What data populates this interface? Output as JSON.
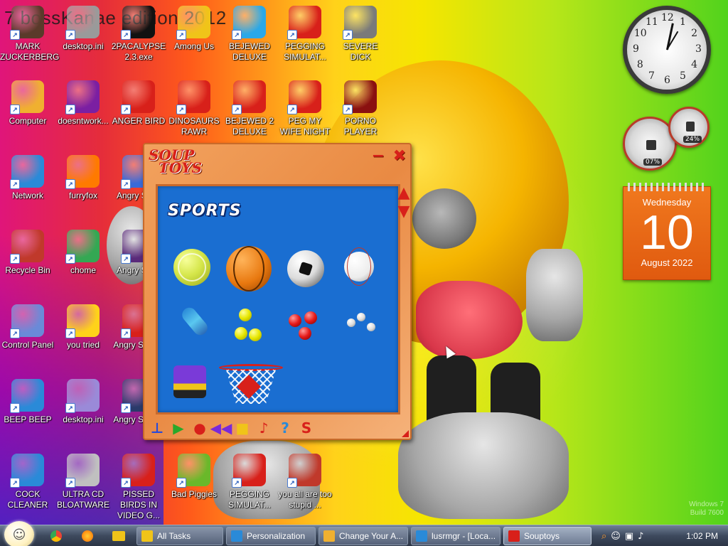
{
  "desktop": {
    "title": "7 bossKanae edition 2012",
    "icons": [
      {
        "label": "MARK ZUCKERBERG",
        "icon": "person-icon",
        "color": "#5a3a2a"
      },
      {
        "label": "desktop.ini",
        "icon": "settings-file-icon",
        "color": "#9a9a9a"
      },
      {
        "label": "2PACALYPSE 2.3.exe",
        "icon": "terminal-icon",
        "color": "#111111"
      },
      {
        "label": "Among Us",
        "icon": "folder-icon",
        "color": "#f0c419"
      },
      {
        "label": "BEJEWED DELUXE",
        "icon": "gem-icon",
        "color": "#2aa8e8"
      },
      {
        "label": "PEGGING SIMULAT...",
        "icon": "p-logo-icon",
        "color": "#d8201a"
      },
      {
        "label": "SEVERE DICK",
        "icon": "gear-icon",
        "color": "#7a7a7a"
      },
      {
        "label": "Computer",
        "icon": "computer-icon",
        "color": "#f0b030"
      },
      {
        "label": "doesntwork...",
        "icon": "yahoo-icon",
        "color": "#7b1fa2"
      },
      {
        "label": "ANGER BIRD",
        "icon": "angry-bird-icon",
        "color": "#d8201a"
      },
      {
        "label": "DINOSAURS RAWR",
        "icon": "angry-bird-icon",
        "color": "#d8201a"
      },
      {
        "label": "BEJEWED 2 DELUXE",
        "icon": "gem-icon",
        "color": "#d8201a"
      },
      {
        "label": "PEG MY WIFE NIGHT",
        "icon": "p-logo-icon",
        "color": "#d8201a"
      },
      {
        "label": "PORNO PLAYER",
        "icon": "flash-icon",
        "color": "#8a1010"
      },
      {
        "label": "Network",
        "icon": "globe-icon",
        "color": "#2a8ad8"
      },
      {
        "label": "furryfox",
        "icon": "firefox-icon",
        "color": "#ff7a00"
      },
      {
        "label": "Angry Seas",
        "icon": "angry-bird-icon",
        "color": "#3a6ad8"
      },
      {
        "label": "Recycle Bin",
        "icon": "recycle-bin-icon",
        "color": "#c0392b"
      },
      {
        "label": "chome",
        "icon": "chrome-icon",
        "color": "#34a853"
      },
      {
        "label": "Angry Spac",
        "icon": "angry-bird-icon",
        "color": "#5a2a7a"
      },
      {
        "label": "Control Panel",
        "icon": "control-panel-icon",
        "color": "#6a8ad8"
      },
      {
        "label": "you tried",
        "icon": "star-icon",
        "color": "#ffd21a"
      },
      {
        "label": "Angry Star W",
        "icon": "angry-bird-icon",
        "color": "#d8201a"
      },
      {
        "label": "BEEP BEEP",
        "icon": "book-icon",
        "color": "#2a8ad8"
      },
      {
        "label": "desktop.ini",
        "icon": "settings-file-icon",
        "color": "#9a8ad8"
      },
      {
        "label": "Angry Star W",
        "icon": "angry-bird-icon",
        "color": "#2a3a6a"
      },
      {
        "label": "COCK CLEANER",
        "icon": "book-icon",
        "color": "#2a8ad8"
      },
      {
        "label": "ULTRA CD BLOATWARE",
        "icon": "cd-icon",
        "color": "#c0c0c0"
      },
      {
        "label": "PISSED BIRDS IN VIDEO G...",
        "icon": "angry-bird-icon",
        "color": "#d8201a"
      },
      {
        "label": "Bad Piggies",
        "icon": "pig-icon",
        "color": "#6ab82a"
      },
      {
        "label": "PEGGING SIMULAT...",
        "icon": "p-logo-icon",
        "color": "#d8201a"
      },
      {
        "label": "you all are too stupid ...",
        "icon": "dev-cpp-icon",
        "color": "#c0392b"
      }
    ]
  },
  "gadgets": {
    "clock": {
      "numbers": [
        "12",
        "1",
        "2",
        "3",
        "4",
        "5",
        "6",
        "7",
        "8",
        "9",
        "10",
        "11"
      ]
    },
    "meter": {
      "cpu": "07%",
      "memory": "24%"
    },
    "calendar": {
      "weekday": "Wednesday",
      "day": "10",
      "month_year": "August 2022"
    }
  },
  "souptoys": {
    "logo_top": "SOUP",
    "logo_bottom": "TOYS",
    "minimize": "−",
    "close": "✖",
    "category": "SPORTS",
    "toys": [
      "tennis-ball",
      "basketball",
      "soccer-ball",
      "baseball",
      "tube",
      "yellow-balls",
      "red-balls",
      "white-balls",
      "roller-skate",
      "basketball-hoop"
    ],
    "toolbar": [
      {
        "name": "weight-tool",
        "glyph": "⊥",
        "color": "#2a4ad8"
      },
      {
        "name": "play-button",
        "glyph": "▶",
        "color": "#2aa82a"
      },
      {
        "name": "record-button",
        "glyph": "●",
        "color": "#d8201a"
      },
      {
        "name": "rewind-button",
        "glyph": "◀◀",
        "color": "#7a2ad8"
      },
      {
        "name": "stop-button",
        "glyph": "■",
        "color": "#f0c419"
      },
      {
        "name": "music-button",
        "glyph": "♪",
        "color": "#d8201a"
      },
      {
        "name": "help-button",
        "glyph": "?",
        "color": "#2a8ad8"
      },
      {
        "name": "soup-button",
        "glyph": "S",
        "color": "#d8201a"
      }
    ]
  },
  "taskbar": {
    "tasks": [
      {
        "label": "All Tasks",
        "icon": "folder-icon",
        "color": "#f0c419"
      },
      {
        "label": "Personalization",
        "icon": "personalization-icon",
        "color": "#2a8ad8"
      },
      {
        "label": "Change Your A...",
        "icon": "gear-icon",
        "color": "#f0b030"
      },
      {
        "label": "lusrmgr - [Loca...",
        "icon": "users-icon",
        "color": "#2a8ad8"
      },
      {
        "label": "Souptoys",
        "icon": "soup-icon",
        "color": "#d8201a"
      }
    ],
    "time": "1:02 PM"
  },
  "watermark": {
    "line1": "Windows 7",
    "line2": "Build 7600"
  }
}
